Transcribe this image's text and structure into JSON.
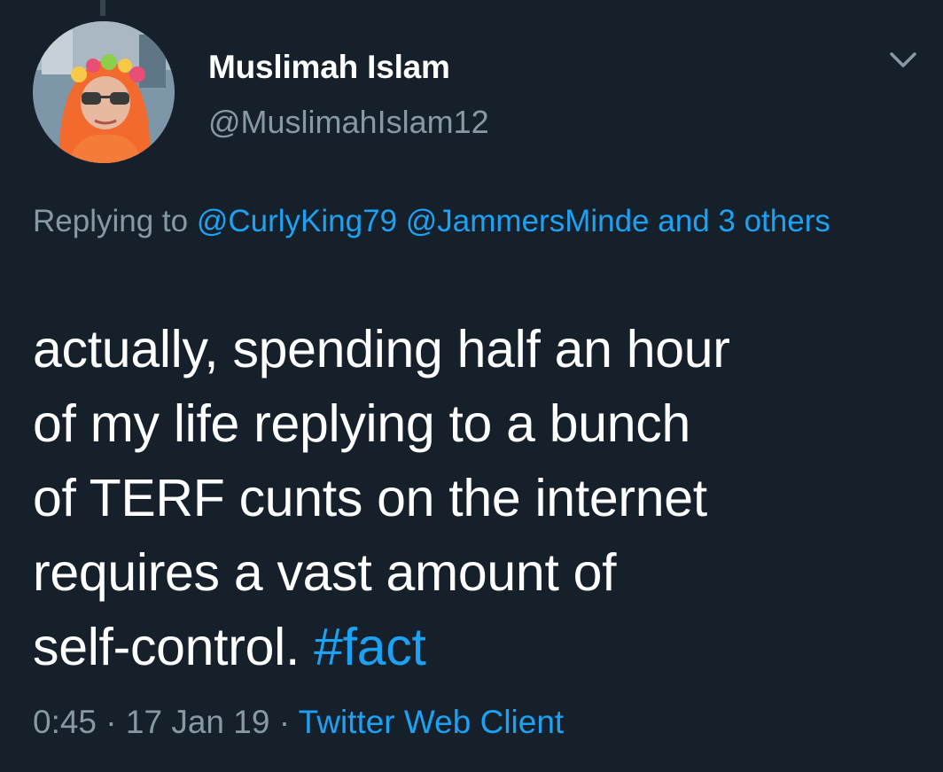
{
  "tweet": {
    "display_name": "Muslimah Islam",
    "handle": "@MuslimahIslam12",
    "reply_prefix": "Replying to",
    "reply_mention_1": "@CurlyKing79",
    "reply_mention_2": "@JammersMinde",
    "reply_others": "and 3 others",
    "text_line_1": "actually, spending half an hour",
    "text_line_2": "of my life replying to a bunch",
    "text_line_3": "of TERF cunts on the internet",
    "text_line_4": "requires a vast amount of",
    "text_line_5_plain": "self-control.",
    "hashtag": "#fact",
    "time": "0:45",
    "separator": "·",
    "date": "17 Jan 19",
    "source": "Twitter Web Client"
  },
  "icons": {
    "menu": "chevron-down-icon",
    "avatar": "avatar-photo"
  },
  "colors": {
    "background": "#15202b",
    "primary_text": "#ffffff",
    "secondary_text": "#8899a6",
    "link": "#1da1f2"
  }
}
